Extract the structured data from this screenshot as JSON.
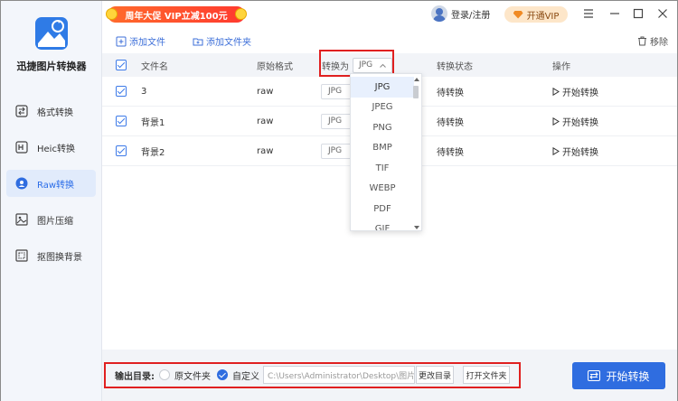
{
  "app": {
    "name": "迅捷图片转换器"
  },
  "sidebar": {
    "items": [
      {
        "label": "格式转换",
        "icon": "format-convert-icon"
      },
      {
        "label": "Heic转换",
        "icon": "heic-icon"
      },
      {
        "label": "Raw转换",
        "icon": "raw-icon",
        "active": true
      },
      {
        "label": "图片压缩",
        "icon": "image-compress-icon"
      },
      {
        "label": "抠图换背景",
        "icon": "cutout-icon"
      }
    ]
  },
  "topbar": {
    "promo": "周年大促 VIP立减100元",
    "login": "登录/注册",
    "vip": "开通VIP"
  },
  "toolbar": {
    "add_file": "添加文件",
    "add_folder": "添加文件夹",
    "remove": "移除"
  },
  "table": {
    "headers": {
      "filename": "文件名",
      "format": "原始格式",
      "convert_to": "转换为",
      "status": "转换状态",
      "action": "操作"
    },
    "header_select": "JPG",
    "rows": [
      {
        "name": "3",
        "format": "raw",
        "target": "JPG",
        "status": "待转换",
        "action": "开始转换"
      },
      {
        "name": "背景1",
        "format": "raw",
        "target": "JPG",
        "status": "待转换",
        "action": "开始转换"
      },
      {
        "name": "背景2",
        "format": "raw",
        "target": "JPG",
        "status": "待转换",
        "action": "开始转换"
      }
    ]
  },
  "dropdown": {
    "options": [
      "JPG",
      "JPEG",
      "PNG",
      "BMP",
      "TIF",
      "WEBP",
      "PDF",
      "GIF"
    ],
    "selected": "JPG"
  },
  "footer": {
    "output_label": "输出目录:",
    "option_original": "原文件夹",
    "option_custom": "自定义",
    "path": "C:\\Users\\Administrator\\Desktop\\图片",
    "change_dir": "更改目录",
    "open_folder": "打开文件夹",
    "start_all": "开始转换"
  },
  "colors": {
    "accent": "#2f6de0",
    "highlight": "#e02020"
  }
}
